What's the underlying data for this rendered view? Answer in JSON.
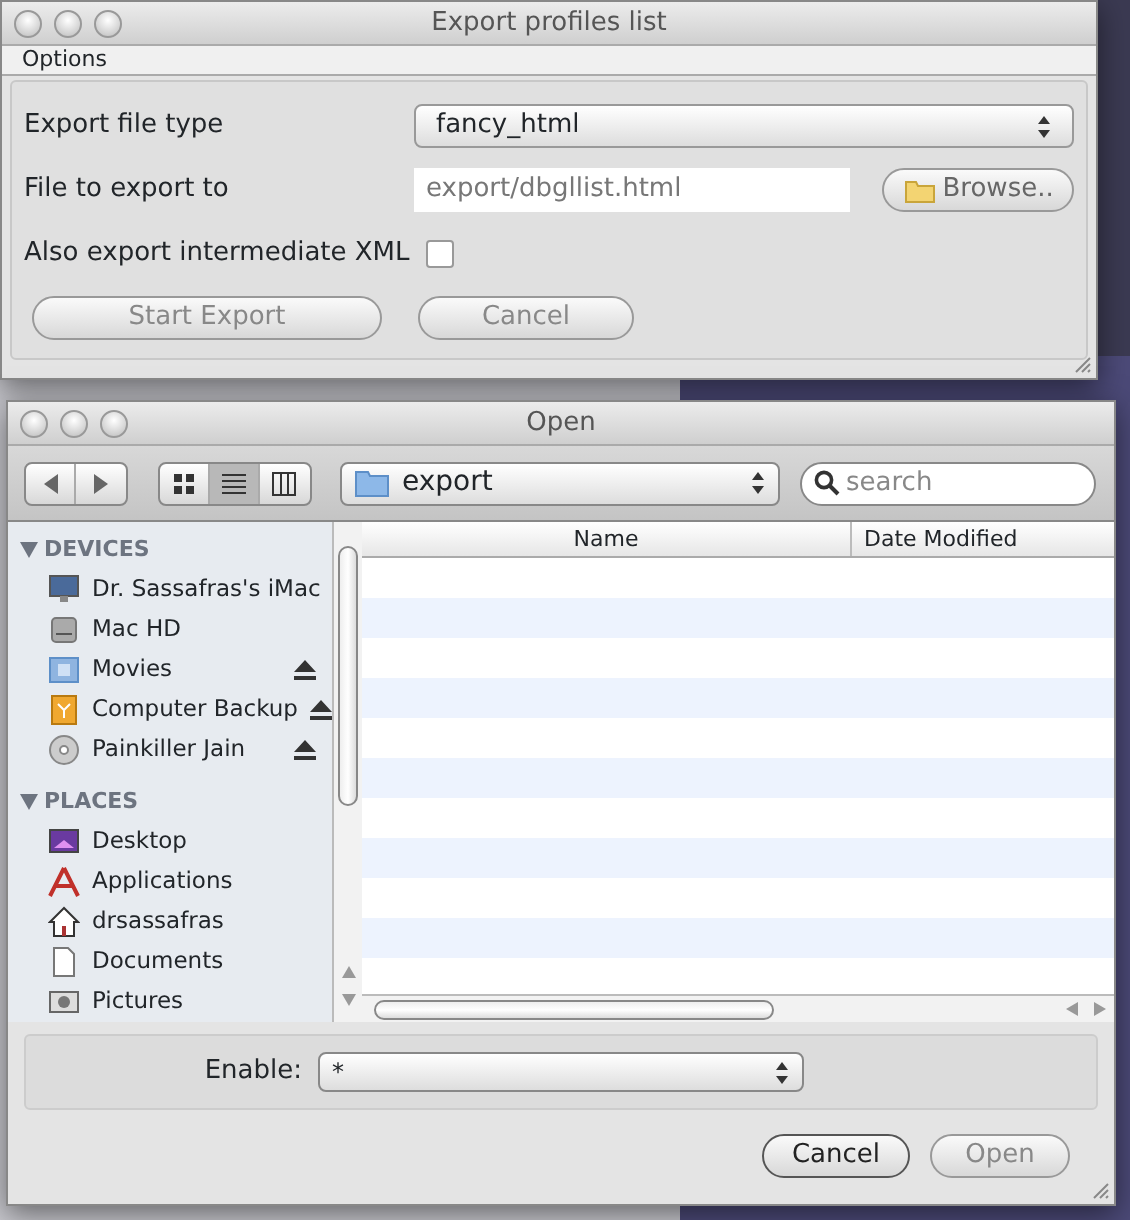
{
  "export_window": {
    "title": "Export profiles list",
    "active": false,
    "menu": [
      "Options"
    ],
    "fields": [
      {
        "kind": "select",
        "label": "Export file type",
        "value": "fancy_html"
      },
      {
        "kind": "file",
        "label": "File to export to",
        "value": "export/dbgllist.html",
        "button": "Browse.."
      },
      {
        "kind": "checkbox",
        "label": "Also export intermediate XML",
        "checked": false
      }
    ],
    "buttons": [
      "Start Export",
      "Cancel"
    ]
  },
  "open_dialog": {
    "title": "Open",
    "view_modes": [
      {
        "kind": "icons",
        "selected": false
      },
      {
        "kind": "list",
        "selected": true
      },
      {
        "kind": "columns",
        "selected": false
      }
    ],
    "location": "export",
    "search": {
      "placeholder": "search"
    },
    "sidebar": [
      {
        "heading": "DEVICES",
        "expanded": true,
        "items": [
          {
            "label": "Dr. Sassafras's iMac",
            "kind": "computer",
            "ejectable": false
          },
          {
            "label": "Mac HD",
            "kind": "disk",
            "ejectable": false
          },
          {
            "label": "Movies",
            "kind": "volume",
            "ejectable": true
          },
          {
            "label": "Computer Backup",
            "kind": "backup",
            "ejectable": true
          },
          {
            "label": "Painkiller Jain",
            "kind": "cd",
            "ejectable": true
          }
        ]
      },
      {
        "heading": "PLACES",
        "expanded": true,
        "items": [
          {
            "label": "Desktop",
            "kind": "desktop",
            "ejectable": false
          },
          {
            "label": "Applications",
            "kind": "apps",
            "ejectable": false
          },
          {
            "label": "drsassafras",
            "kind": "home",
            "ejectable": false
          },
          {
            "label": "Documents",
            "kind": "document",
            "ejectable": false
          },
          {
            "label": "Pictures",
            "kind": "pictures",
            "ejectable": false
          }
        ]
      }
    ],
    "columns": [
      "Name",
      "Date Modified"
    ],
    "filter": {
      "label": "Enable:",
      "value": "*"
    },
    "buttons": [
      {
        "label": "Cancel",
        "disabled": false
      },
      {
        "label": "Open",
        "disabled": true
      }
    ]
  }
}
